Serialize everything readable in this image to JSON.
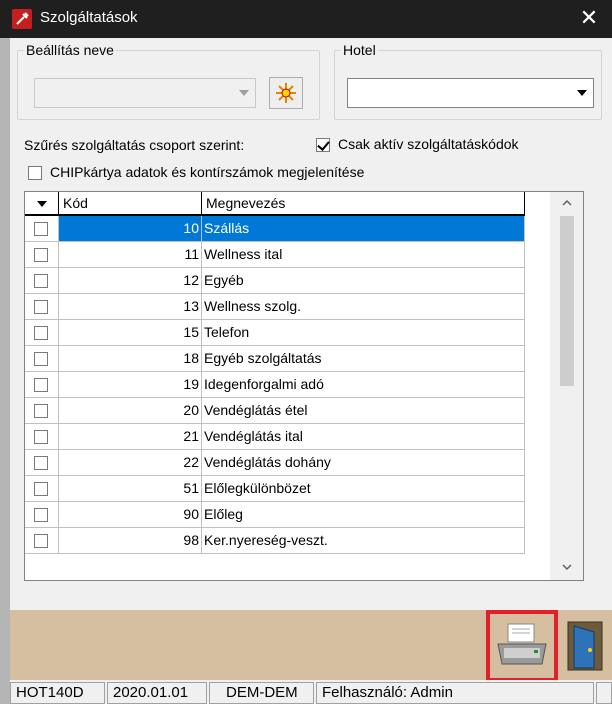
{
  "window": {
    "title": "Szolgáltatások"
  },
  "setting_group": {
    "legend": "Beállítás neve"
  },
  "hotel_group": {
    "legend": "Hotel",
    "value": ""
  },
  "filter": {
    "group_label": "Szűrés szolgáltatás csoport szerint:",
    "active_only_label": "Csak aktív szolgáltatáskódok",
    "active_only_checked": true,
    "chip_label": "CHIPkártya adatok és kontírszámok megjelenítése",
    "chip_checked": false
  },
  "grid": {
    "columns": [
      "Kód",
      "Megnevezés"
    ],
    "rows": [
      {
        "code": "10",
        "name": "Szállás",
        "selected": true
      },
      {
        "code": "11",
        "name": "Wellness ital"
      },
      {
        "code": "12",
        "name": "Egyéb"
      },
      {
        "code": "13",
        "name": "Wellness szolg."
      },
      {
        "code": "15",
        "name": "Telefon"
      },
      {
        "code": "18",
        "name": "Egyéb szolgáltatás"
      },
      {
        "code": "19",
        "name": "Idegenforgalmi adó"
      },
      {
        "code": "20",
        "name": "Vendéglátás étel"
      },
      {
        "code": "21",
        "name": "Vendéglátás ital"
      },
      {
        "code": "22",
        "name": "Vendéglátás dohány"
      },
      {
        "code": "51",
        "name": "Előlegkülönbözet"
      },
      {
        "code": "90",
        "name": "Előleg"
      },
      {
        "code": "98",
        "name": "Ker.nyereség-veszt."
      }
    ]
  },
  "status": {
    "module": "HOT140D",
    "date": "2020.01.01",
    "db": "DEM-DEM",
    "user": "Felhasználó: Admin"
  },
  "icons": {
    "app": "app-icon",
    "close": "close-icon",
    "star": "star-icon",
    "print": "printer-icon",
    "exit": "exit-door-icon"
  },
  "colors": {
    "titlebar": "#1f1f1f",
    "selection": "#0078d7",
    "bottom_bar": "#d6bfa0",
    "highlight": "#e3202a"
  }
}
